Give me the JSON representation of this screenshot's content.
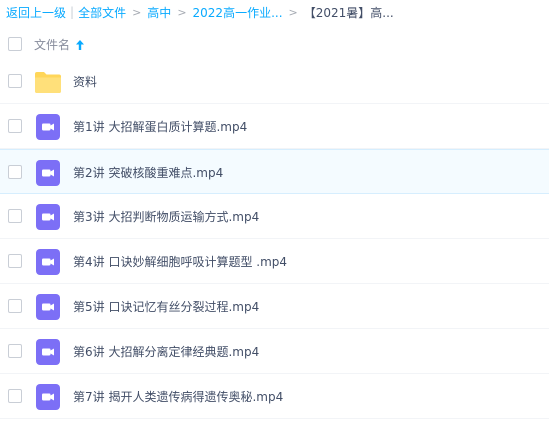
{
  "breadcrumb": {
    "back_label": "返回上一级",
    "all_files_label": "全部文件",
    "items": [
      "高中",
      "2022高一作业...",
      "【2021暑】高..."
    ]
  },
  "header": {
    "column_name_label": "文件名",
    "sort_icon": "arrow-up-icon"
  },
  "files": [
    {
      "name": "资料",
      "type": "folder",
      "icon": "folder-icon"
    },
    {
      "name": "第1讲 大招解蛋白质计算题.mp4",
      "type": "video",
      "icon": "video-icon"
    },
    {
      "name": "第2讲 突破核酸重难点.mp4",
      "type": "video",
      "icon": "video-icon"
    },
    {
      "name": "第3讲 大招判断物质运输方式.mp4",
      "type": "video",
      "icon": "video-icon"
    },
    {
      "name": "第4讲 口诀妙解细胞呼吸计算题型 .mp4",
      "type": "video",
      "icon": "video-icon"
    },
    {
      "name": "第5讲 口诀记忆有丝分裂过程.mp4",
      "type": "video",
      "icon": "video-icon"
    },
    {
      "name": "第6讲 大招解分离定律经典题.mp4",
      "type": "video",
      "icon": "video-icon"
    },
    {
      "name": "第7讲 揭开人类遗传病得遗传奥秘.mp4",
      "type": "video",
      "icon": "video-icon"
    }
  ],
  "colors": {
    "link": "#09aaff",
    "folder": "#ffd659",
    "video": "#7c6ff6",
    "hover_row": "#f4fbff"
  }
}
